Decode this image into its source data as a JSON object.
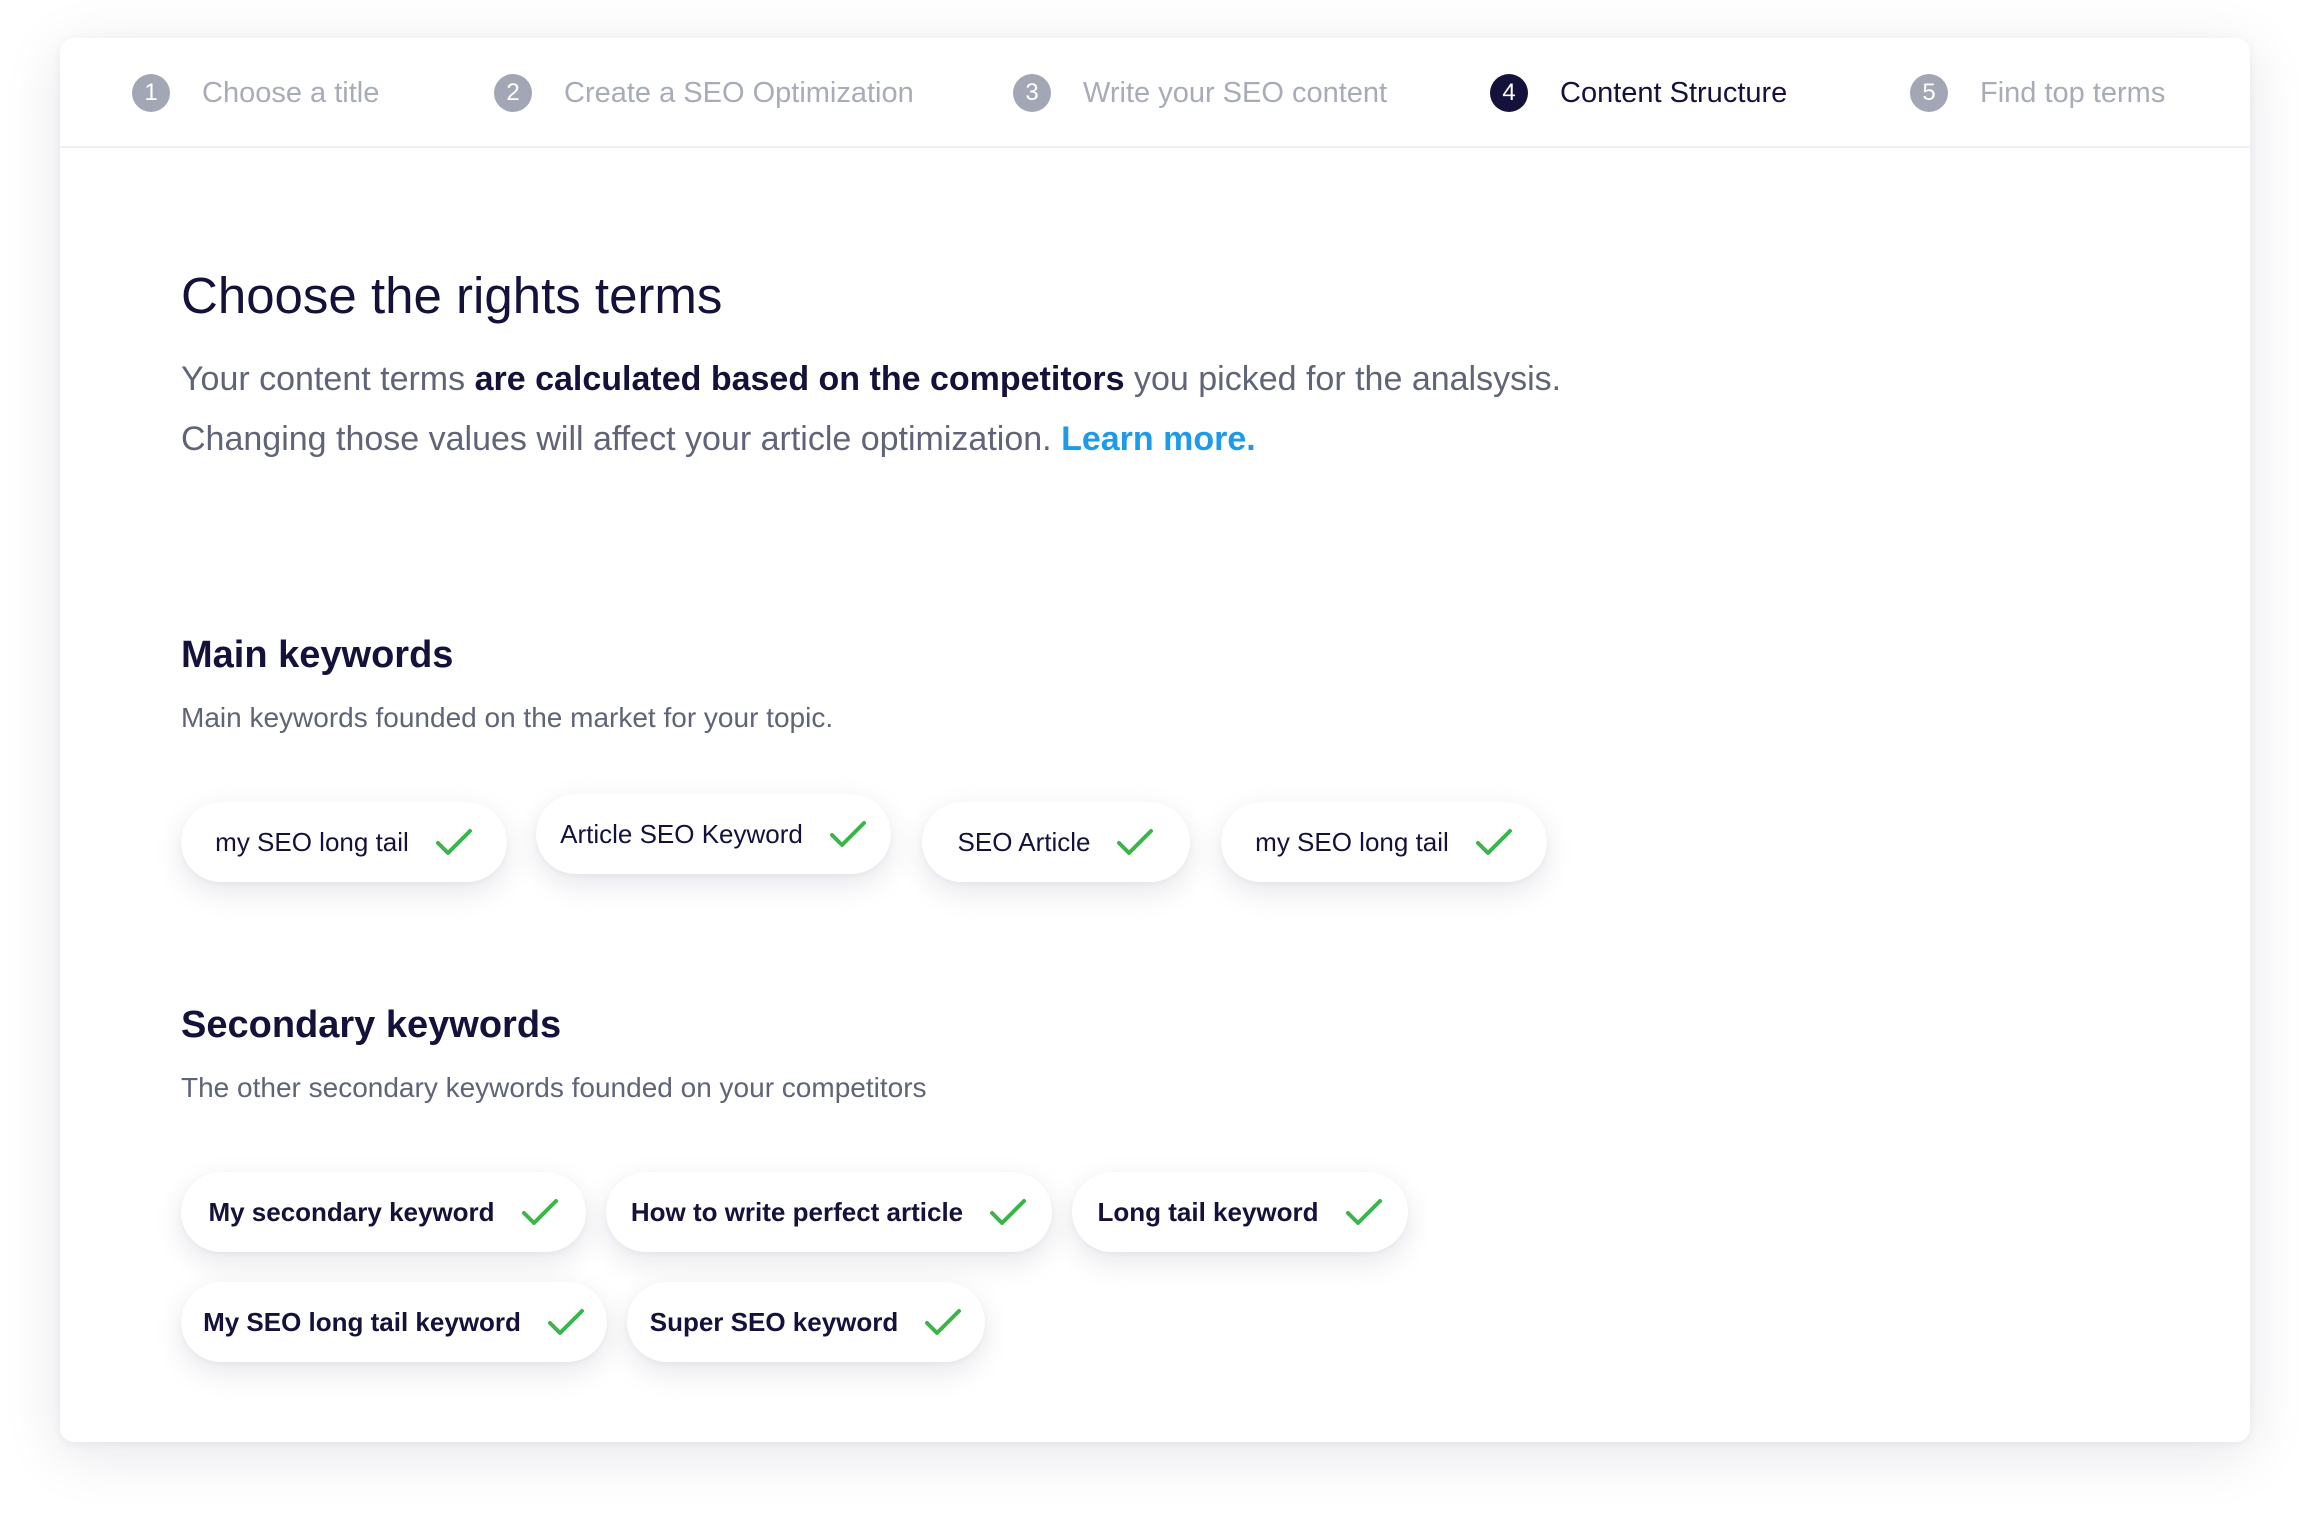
{
  "stepper": {
    "steps": [
      {
        "number": "1",
        "label": "Choose a title"
      },
      {
        "number": "2",
        "label": "Create a SEO Optimization"
      },
      {
        "number": "3",
        "label": "Write your SEO content"
      },
      {
        "number": "4",
        "label": "Content Structure"
      },
      {
        "number": "5",
        "label": "Find top terms"
      }
    ],
    "active_step": "4"
  },
  "intro": {
    "title": "Choose the rights terms",
    "line1_pre": "Your content terms ",
    "line1_bold": "are calculated based on the competitors",
    "line1_post": " you picked for the analsysis.",
    "line2": "Changing those values will affect your article optimization. ",
    "learn_more": "Learn more."
  },
  "main_keywords": {
    "title": "Main keywords",
    "subtitle": "Main keywords founded on the market for your topic.",
    "chips": [
      "my SEO long tail",
      "Article SEO Keyword",
      "SEO Article",
      "my SEO long tail"
    ]
  },
  "secondary_keywords": {
    "title": "Secondary keywords",
    "subtitle": "The other secondary keywords founded on your competitors",
    "chips": [
      "My secondary  keyword",
      "How to write perfect article",
      "Long tail keyword",
      "My SEO long tail keyword",
      "Super SEO keyword"
    ]
  },
  "colors": {
    "primary": "#14123a",
    "muted": "#a8acb8",
    "link": "#1e9be8",
    "check": "#3bb54a"
  },
  "icons": {
    "check": "check-icon"
  }
}
